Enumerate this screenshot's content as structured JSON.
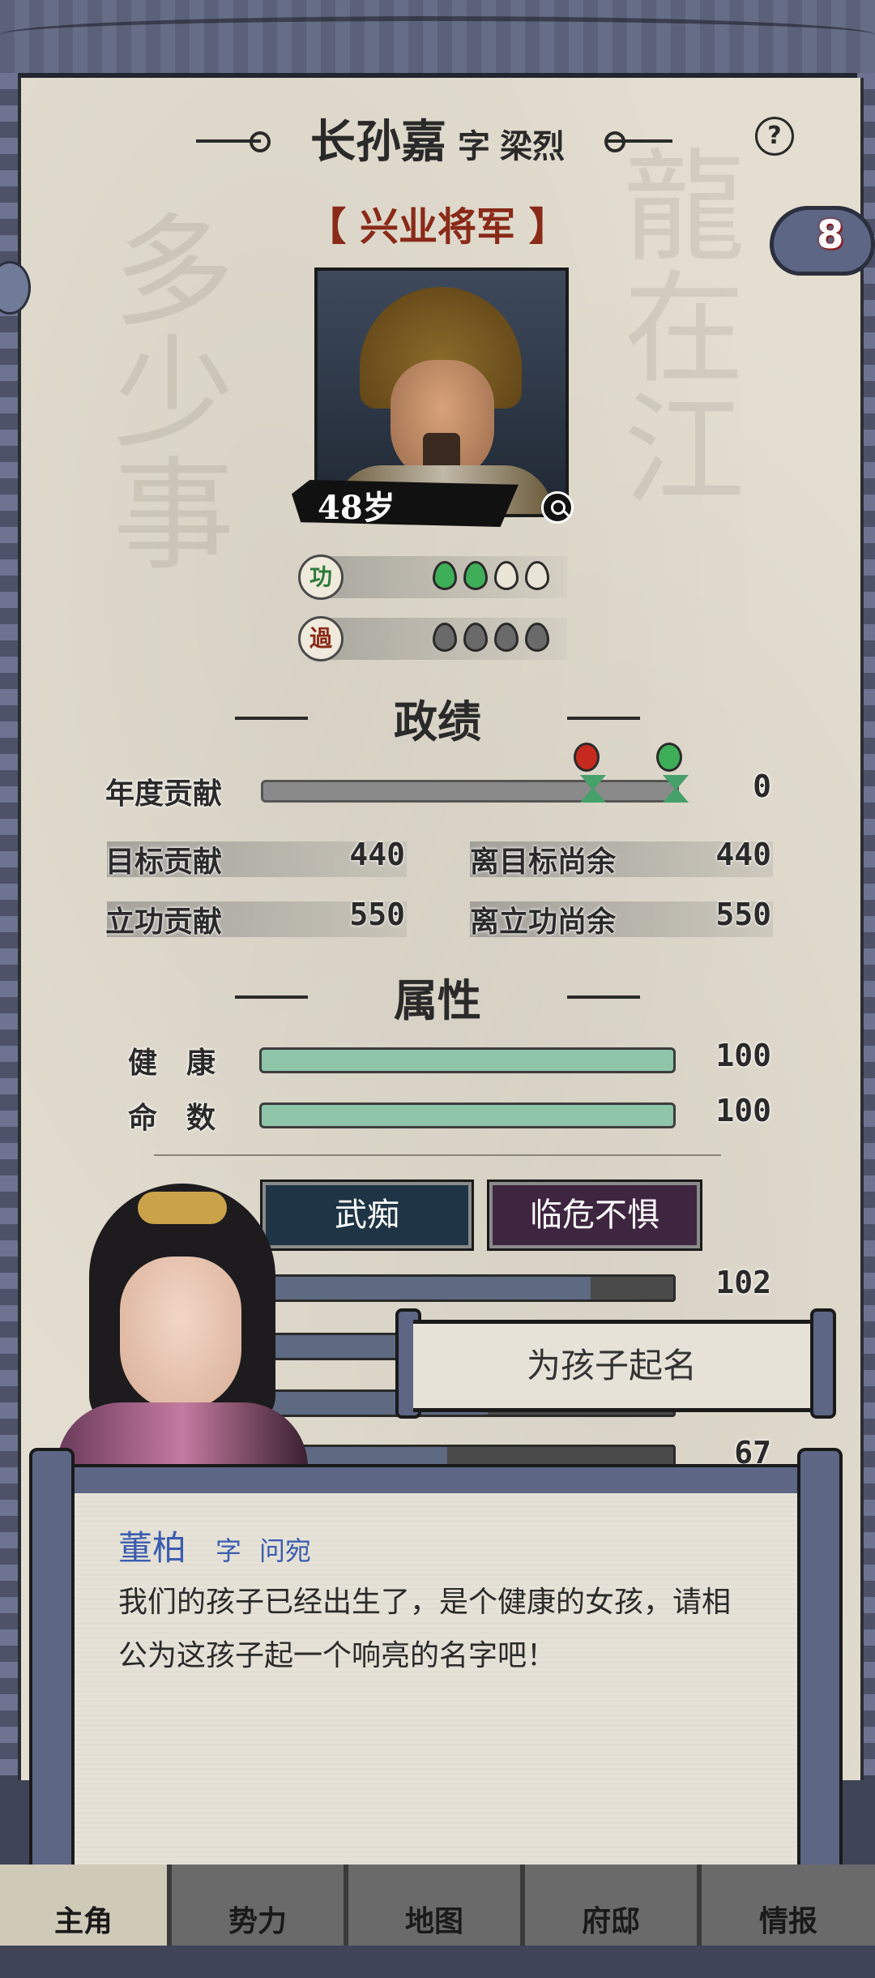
{
  "header": {
    "name": "长孙嘉",
    "zi_label": "字",
    "courtesy_name": "梁烈",
    "title": "【 兴业将军 】",
    "help_icon": "?",
    "badge_count": "8"
  },
  "portrait": {
    "age": "48岁"
  },
  "merit": {
    "merit_badge": "功",
    "fault_badge": "過",
    "merit_filled": 2,
    "merit_total": 4,
    "fault_total": 4
  },
  "performance": {
    "title": "政绩",
    "annual_label": "年度贡献",
    "annual_value": "0",
    "target_label": "目标贡献",
    "target_value": "440",
    "remain_target_label": "离目标尚余",
    "remain_target_value": "440",
    "merit_label": "立功贡献",
    "merit_value": "550",
    "remain_merit_label": "离立功尚余",
    "remain_merit_value": "550"
  },
  "attributes": {
    "title": "属性",
    "health_label": "健　康",
    "health_value": "100",
    "fate_label": "命　数",
    "fate_value": "100",
    "trait1": "武痴",
    "trait2": "临危不惧",
    "skill1_value": "102",
    "skill4_value": "67"
  },
  "action": {
    "name_child_button": "为孩子起名"
  },
  "dialog": {
    "speaker": "董柏",
    "zi_label": "字",
    "speaker_courtesy": "问宛",
    "text": "我们的孩子已经出生了，是个健康的女孩，请相公为这孩子起一个响亮的名字吧！"
  },
  "nav": {
    "tabs": [
      "主角",
      "势力",
      "地图",
      "府邸",
      "情报"
    ]
  },
  "colors": {
    "accent_title": "#8a2a18",
    "speaker": "#3a5cb0",
    "health_bar": "#8ec5a8"
  }
}
